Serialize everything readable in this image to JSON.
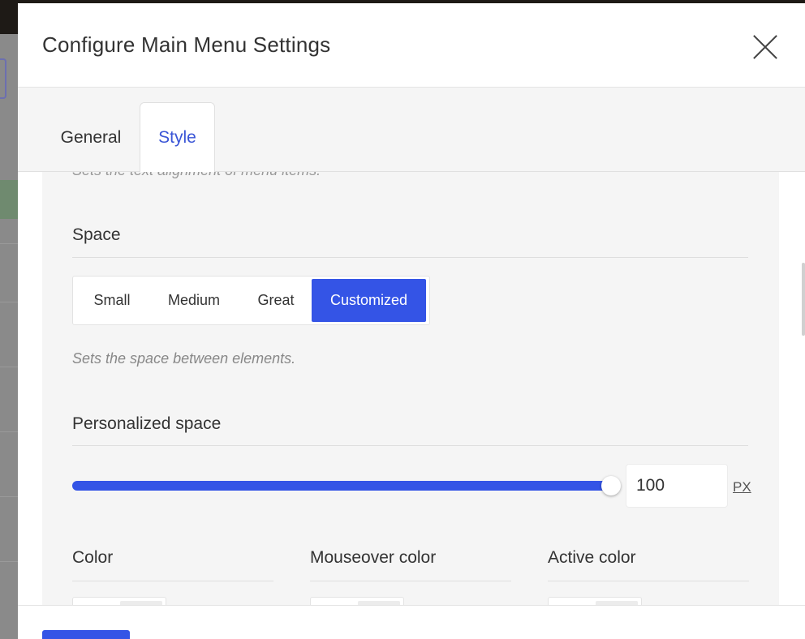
{
  "modal": {
    "title": "Configure Main Menu Settings"
  },
  "tabs": [
    {
      "label": "General",
      "active": false
    },
    {
      "label": "Style",
      "active": true
    }
  ],
  "cut_hint": "Sets the text alignment of menu items.",
  "space": {
    "title": "Space",
    "options": [
      "Small",
      "Medium",
      "Great",
      "Customized"
    ],
    "selected": "Customized",
    "hint": "Sets the space between elements."
  },
  "personalized_space": {
    "title": "Personalized space",
    "value": "100",
    "unit": "PX",
    "slider_fraction": 1.0
  },
  "colors": [
    {
      "label": "Color"
    },
    {
      "label": "Mouseover color"
    },
    {
      "label": "Active color"
    }
  ],
  "theme": {
    "accent": "#3454e6",
    "active_tab_text": "#3a55d6"
  }
}
